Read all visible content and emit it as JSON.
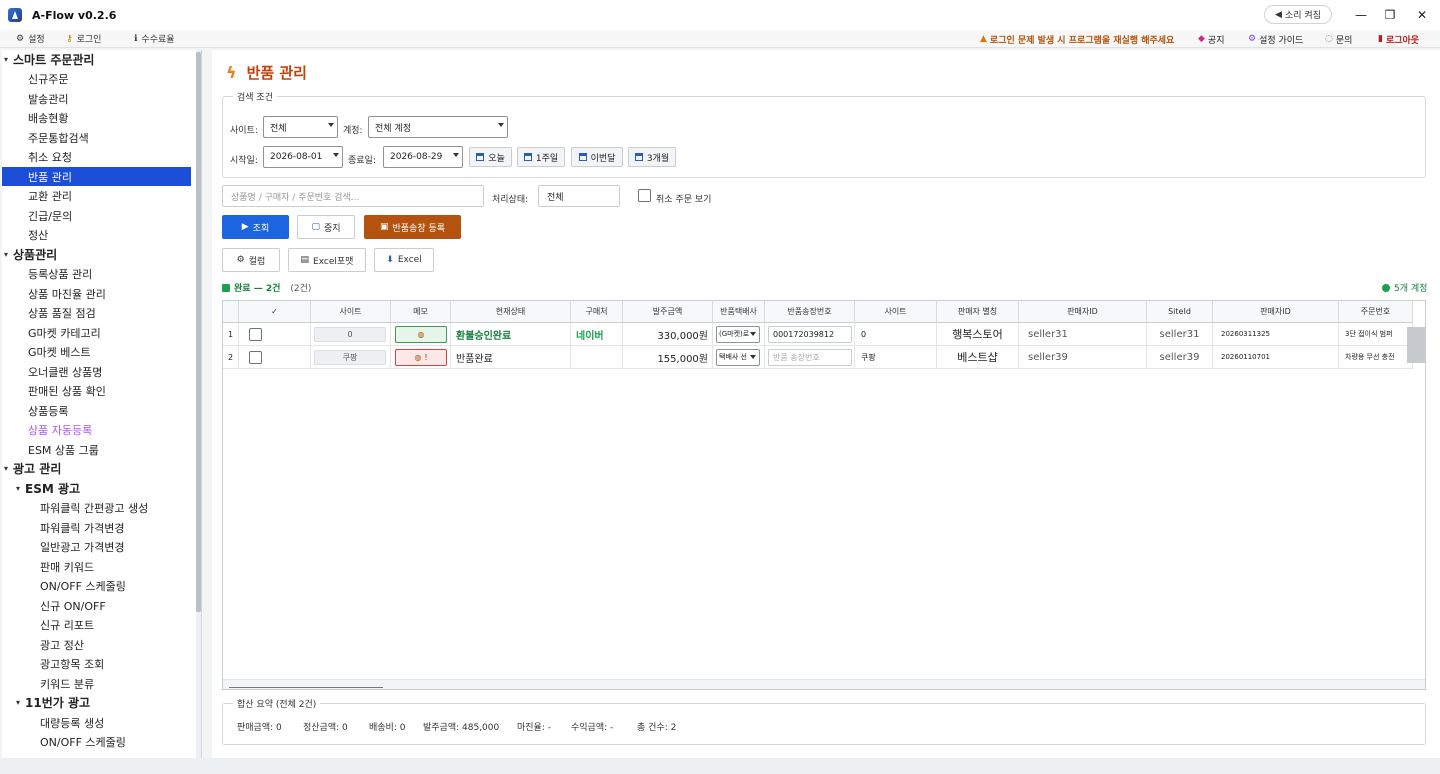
{
  "app": {
    "title": "A-Flow v0.2.6",
    "sound_label": "소리 켜짐"
  },
  "menubar": {
    "left": [
      {
        "icon": "gear-icon",
        "label": "설정"
      },
      {
        "icon": "key-icon",
        "label": "로그인"
      },
      {
        "icon": "info-icon",
        "label": "수수료율"
      }
    ],
    "warning": "로그인 문제 발생 시 프로그램을 재실행 해주세요",
    "notice": "공지",
    "guide": "설정 가이드",
    "inquiry": "문의",
    "logout": "로그아웃"
  },
  "sidebar": {
    "smart": "스마트 주문관리",
    "smart_items": [
      "신규주문",
      "발송관리",
      "배송현황",
      "주문통합검색",
      "취소 요청",
      "반품 관리",
      "교환 관리",
      "긴급/문의",
      "정산"
    ],
    "product": "상품관리",
    "product_items": [
      "등록상품 관리",
      "상품 마진율 관리",
      "상품 품질 점검",
      "G마켓 카테고리",
      "G마켓 베스트",
      "오너클랜 상품명",
      "판매된 상품 확인",
      "상품등록",
      "상품 자동등록",
      "ESM 상품 그룹"
    ],
    "ad": "광고 관리",
    "esm": "ESM 광고",
    "esm_items": [
      "파워클릭 간편광고 생성",
      "파워클릭 가격변경",
      "일반광고 가격변경",
      "판매 키워드",
      "ON/OFF 스케줄링",
      "신규 ON/OFF",
      "신규 리포트",
      "광고 정산",
      "광고항목 조회",
      "키워드 분류"
    ],
    "st11": "11번가 광고",
    "st11_items": [
      "대량등록 생성",
      "ON/OFF 스케줄링"
    ]
  },
  "page": {
    "title": "반품 관리",
    "search_legend": "검색 조건",
    "site_label": "사이트:",
    "site_value": "전체",
    "account_label": "계정:",
    "account_value": "전체 계정",
    "start_label": "시작일:",
    "start_value": "2026-08-01",
    "end_label": "종료일:",
    "end_value": "2026-08-29",
    "quick": [
      "오늘",
      "1주일",
      "이번달",
      "3개월"
    ],
    "search_placeholder": "상품명 / 구매자 / 주문번호 검색...",
    "status_label": "처리상태:",
    "status_value": "전체",
    "cancel_view": "취소 주문 보기",
    "btn_search": "조회",
    "btn_stop": "중지",
    "btn_register": "반품송장 등록",
    "btn_column": "컬럼",
    "btn_excel_format": "Excel포맷",
    "btn_excel": "Excel",
    "status_done": "완료 — 2건",
    "status_count": "(2건)",
    "accounts": "5개 계정"
  },
  "grid": {
    "headers": [
      "",
      "✓",
      "사이트",
      "메모",
      "현재상태",
      "구매처",
      "발주금액",
      "반품택배사",
      "반품송장번호",
      "사이트",
      "판매자 별칭",
      "판매자ID",
      "SiteId",
      "판매자ID",
      "주문번호"
    ],
    "rows": [
      {
        "num": "1",
        "site": "0",
        "memo": "",
        "state": "환불승인완료",
        "buyer": "네이버",
        "amount": "330,000원",
        "courier": "(G마켓)로",
        "invoice": "000172039812",
        "site2": "0",
        "alias": "행복스토어",
        "seller": "seller31",
        "siteid": "seller31",
        "seller2": "20260311325",
        "order": "3단 접이식 범퍼"
      },
      {
        "num": "2",
        "site": "쿠팡",
        "memo": "!",
        "state": "반품완료",
        "buyer": "",
        "amount": "155,000원",
        "courier": "택배사 선",
        "invoice": "반품 송장번호",
        "site2": "쿠팡",
        "alias": "베스트샵",
        "seller": "seller39",
        "siteid": "seller39",
        "seller2": "20260110701",
        "order": "차량용 무선 충전"
      }
    ]
  },
  "summary": {
    "legend": "합산 요약 (전체 2건)",
    "items": [
      "판매금액: 0",
      "정산금액: 0",
      "배송비: 0",
      "발주금액: 485,000",
      "마진율: -",
      "수익금액: -",
      "총 건수: 2"
    ]
  },
  "colors": {
    "accent": "#1d64e0",
    "brand_orange": "#c2410c",
    "active_nav": "#1d4ed8"
  }
}
